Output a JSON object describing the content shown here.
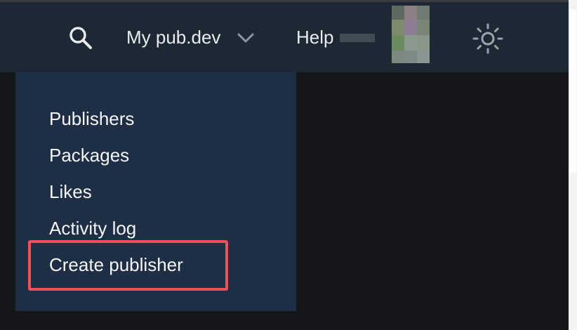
{
  "header": {
    "search_icon": "search-icon",
    "my_pubdev_label": "My pub.dev",
    "chevron_icon": "chevron-down-icon",
    "help_label": "Help",
    "theme_icon": "sun-icon"
  },
  "dropdown": {
    "items": [
      {
        "label": "Publishers"
      },
      {
        "label": "Packages"
      },
      {
        "label": "Likes"
      },
      {
        "label": "Activity log"
      },
      {
        "label": "Create publisher"
      }
    ]
  },
  "colors": {
    "header_bg": "#1c2834",
    "dropdown_bg": "#1e2f45",
    "highlight_border": "#f0505a",
    "text": "#f3f5f7"
  }
}
